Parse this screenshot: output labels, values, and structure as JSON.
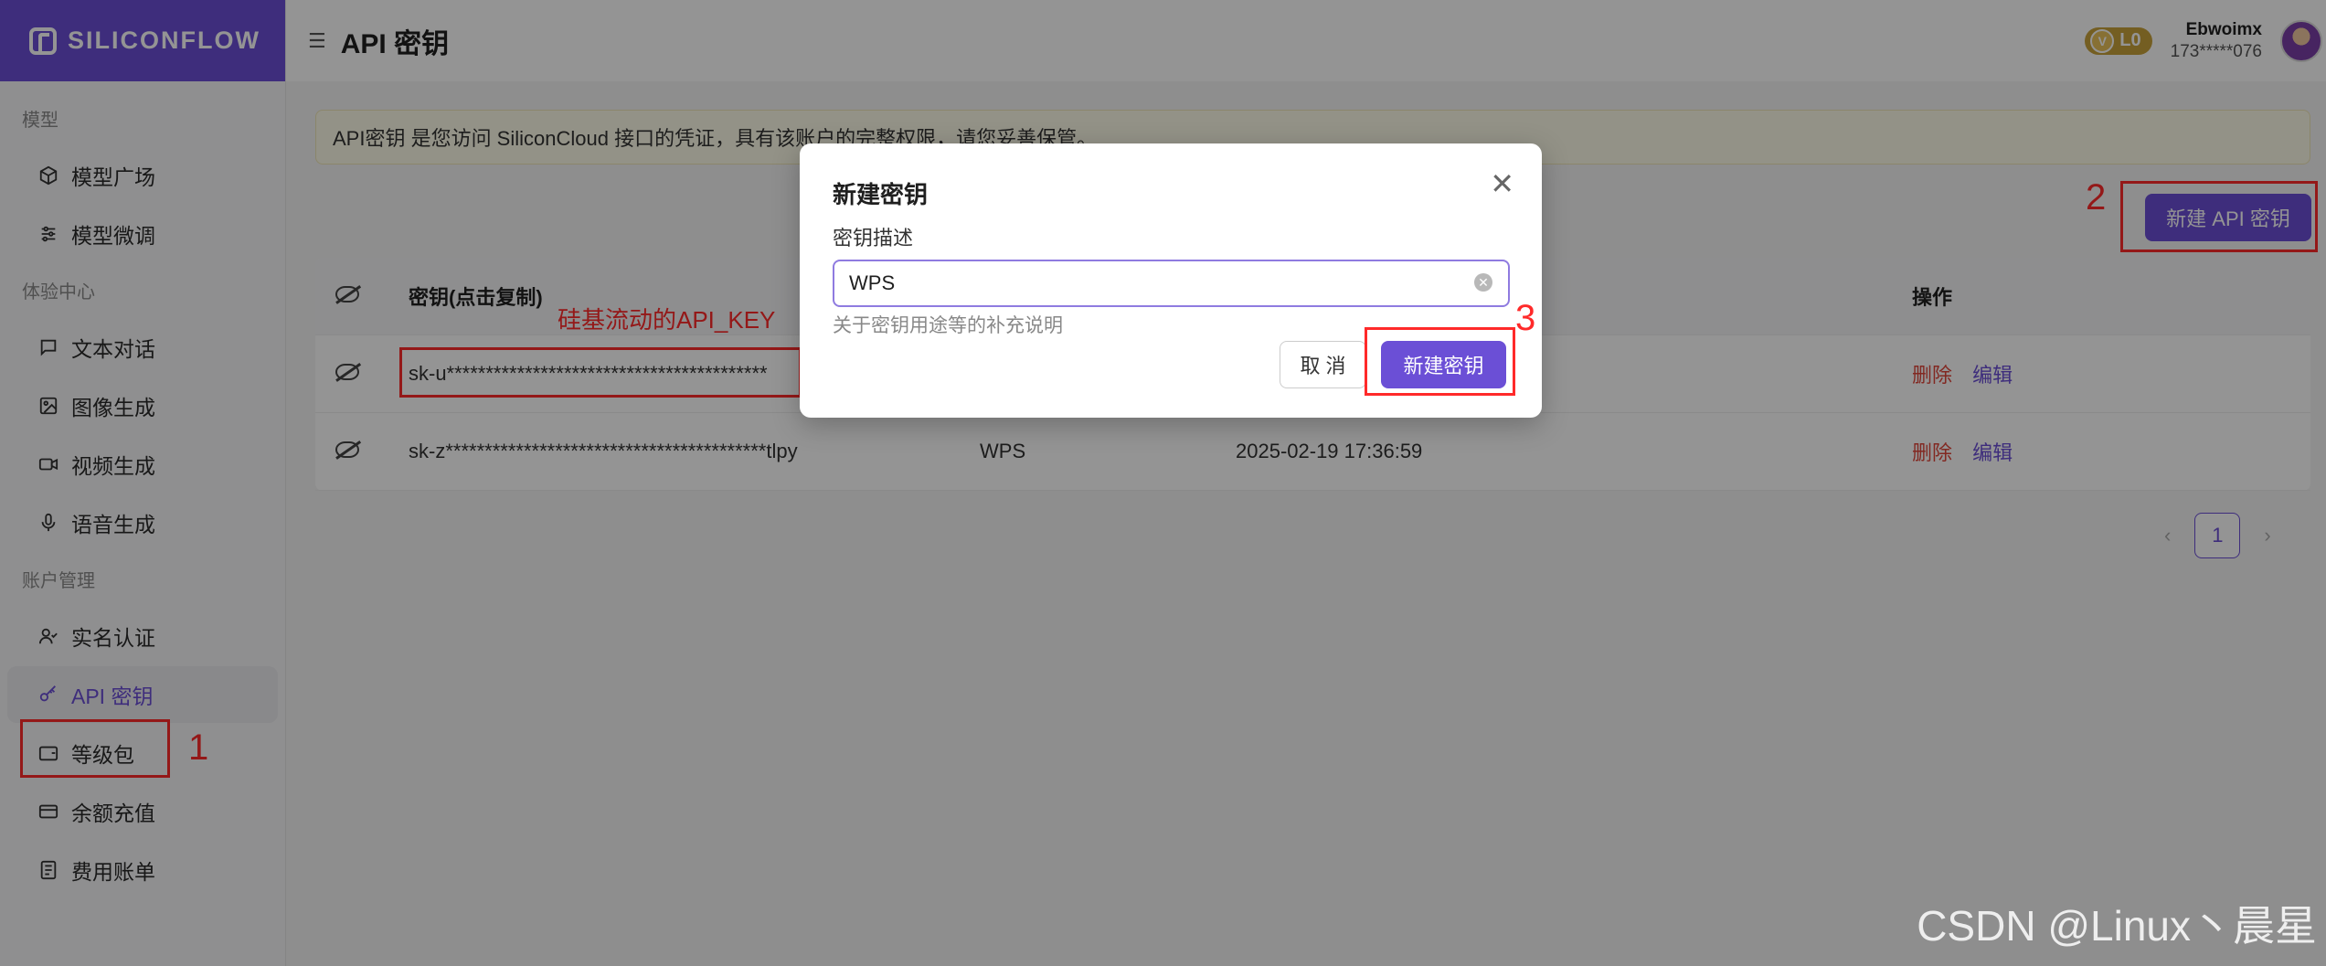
{
  "brand": {
    "name": "SILICONFLOW"
  },
  "header": {
    "title": "API 密钥",
    "level": "L0",
    "level_mark": "V",
    "user_name": "Ebwoimx",
    "user_phone": "173*****076"
  },
  "sidebar": {
    "groups": [
      {
        "label": "模型",
        "items": [
          {
            "label": "模型广场",
            "icon": "cube-icon"
          },
          {
            "label": "模型微调",
            "icon": "sliders-icon"
          }
        ]
      },
      {
        "label": "体验中心",
        "items": [
          {
            "label": "文本对话",
            "icon": "chat-icon"
          },
          {
            "label": "图像生成",
            "icon": "image-icon"
          },
          {
            "label": "视频生成",
            "icon": "video-icon"
          },
          {
            "label": "语音生成",
            "icon": "mic-icon"
          }
        ]
      },
      {
        "label": "账户管理",
        "items": [
          {
            "label": "实名认证",
            "icon": "user-check-icon"
          },
          {
            "label": "API 密钥",
            "icon": "key-icon",
            "active": true
          },
          {
            "label": "等级包",
            "icon": "wallet-icon"
          },
          {
            "label": "余额充值",
            "icon": "card-icon"
          },
          {
            "label": "费用账单",
            "icon": "bill-icon"
          }
        ]
      }
    ]
  },
  "notice": "API密钥 是您访问 SiliconCloud 接口的凭证，具有该账户的完整权限，请您妥善保管。",
  "new_key_button": "新建 API 密钥",
  "table": {
    "headers": {
      "key": "密钥(点击复制)",
      "ops": "操作"
    },
    "rows": [
      {
        "key": "sk-u*****************************************",
        "desc": "",
        "time": "",
        "delete": "删除",
        "edit": "编辑"
      },
      {
        "key": "sk-z*****************************************tlpy",
        "desc": "WPS",
        "time": "2025-02-19 17:36:59",
        "delete": "删除",
        "edit": "编辑"
      }
    ]
  },
  "pagination": {
    "current": "1"
  },
  "modal": {
    "title": "新建密钥",
    "label": "密钥描述",
    "input_value": "WPS",
    "help": "关于密钥用途等的补充说明",
    "cancel": "取 消",
    "create": "新建密钥"
  },
  "annotations": {
    "num1": "1",
    "num2": "2",
    "num3": "3",
    "key_label": "硅基流动的API_KEY"
  },
  "watermark": "CSDN @Linux丶晨星",
  "colors": {
    "accent": "#6b4fd6",
    "danger": "#e0453a",
    "annotation": "#ff2a2a"
  }
}
